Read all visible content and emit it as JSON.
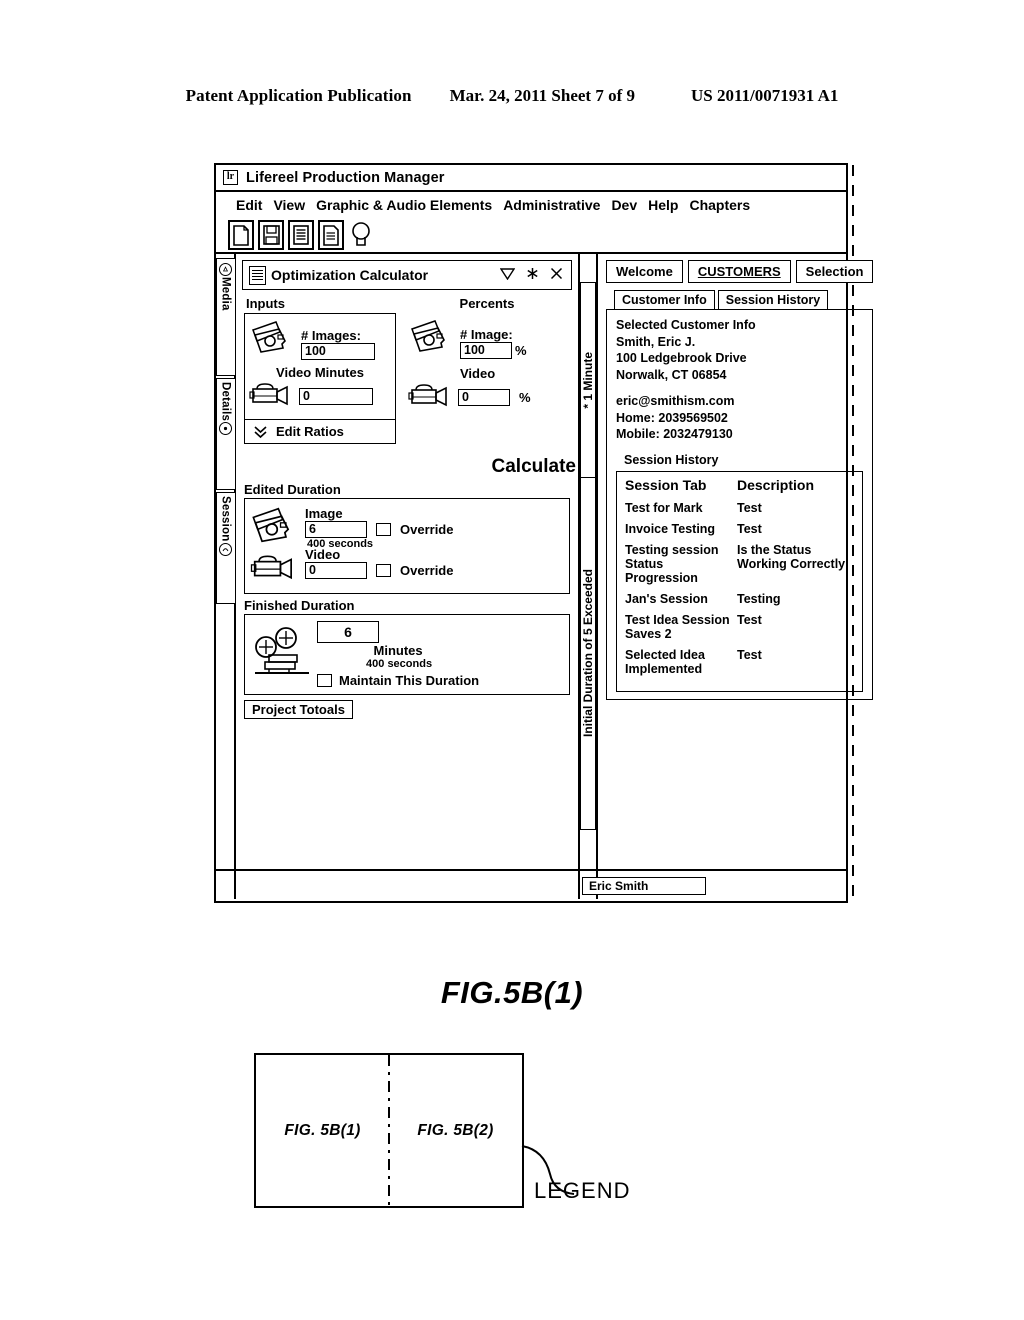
{
  "patent_header": {
    "publication": "Patent Application Publication",
    "date_sheet": "Mar. 24, 2011  Sheet 7 of 9",
    "number": "US 2011/0071931 A1"
  },
  "app": {
    "badge": "lr",
    "title": "Lifereel Production Manager",
    "menu": [
      "Edit",
      "View",
      "Graphic & Audio Elements",
      "Administrative",
      "Dev",
      "Help",
      "Chapters"
    ],
    "toolbar_icons": [
      "new-document-icon",
      "save-icon",
      "report-icon",
      "document-text-icon",
      "lightbulb-icon"
    ],
    "rail_tabs": [
      {
        "label": "Media",
        "icon": "circle-icon"
      },
      {
        "label": "Details",
        "icon": "circle-icon"
      },
      {
        "label": "Session",
        "icon": "circle-icon"
      }
    ],
    "status_user": "Eric Smith"
  },
  "calculator": {
    "panel_title": "Optimization Calculator",
    "panel_icon": "document-lines-icon",
    "controls": [
      "triangle-down-icon",
      "asterisk-icon",
      "close-icon"
    ],
    "inputs_label": "Inputs",
    "percents_label": "Percents",
    "inputs": {
      "images_label": "# Images:",
      "images_value": "100",
      "video_label": "Video Minutes",
      "video_value": "0"
    },
    "percents": {
      "images_label": "# Image:",
      "images_value": "100",
      "images_unit": "%",
      "video_label": "Video",
      "video_value": "0",
      "video_unit": "%"
    },
    "edit_ratios": "Edit Ratios",
    "calculate": "Calculate",
    "edited_duration": {
      "title": "Edited Duration",
      "image_label": "Image",
      "image_value": "6",
      "image_seconds": "400 seconds",
      "image_override": "Override",
      "video_label": "Video",
      "video_value": "0",
      "video_override": "Override"
    },
    "finished_duration": {
      "title": "Finished Duration",
      "value": "6",
      "units": "Minutes",
      "seconds": "400 seconds",
      "maintain": "Maintain This Duration"
    },
    "project_totals": "Project Totoals",
    "vertical_labels": {
      "minute": "* 1 Minute",
      "initial": "Initial Duration of 5 Exceeded"
    }
  },
  "right_panel": {
    "tabs": [
      {
        "label": "Welcome",
        "active": false
      },
      {
        "label": "CUSTOMERS",
        "active": true
      },
      {
        "label": "Selection",
        "active": false
      }
    ],
    "subtabs": [
      {
        "label": "Customer Info"
      },
      {
        "label": "Session History"
      }
    ],
    "customer": {
      "heading": "Selected Customer Info",
      "name": "Smith, Eric J.",
      "address": "100 Ledgebrook Drive",
      "city_state_zip": "Norwalk, CT 06854",
      "email": "eric@smithism.com",
      "home": "Home: 2039569502",
      "mobile": "Mobile: 2032479130"
    },
    "session_history": {
      "title": "Session History",
      "columns": [
        "Session Tab",
        "Description"
      ],
      "rows": [
        {
          "tab": "Test for Mark",
          "description": "Test"
        },
        {
          "tab": "Invoice Testing",
          "description": "Test"
        },
        {
          "tab": "Testing session Status Progression",
          "description": "Is the Status Working Correctly"
        },
        {
          "tab": "Jan's Session",
          "description": "Testing"
        },
        {
          "tab": "Test Idea Session Saves 2",
          "description": "Test"
        },
        {
          "tab": "Selected Idea Implemented",
          "description": "Test"
        }
      ]
    }
  },
  "figure": {
    "caption": "FIG.5B(1)",
    "legend_left": "FIG. 5B(1)",
    "legend_right": "FIG. 5B(2)",
    "legend_label": "LEGEND"
  }
}
